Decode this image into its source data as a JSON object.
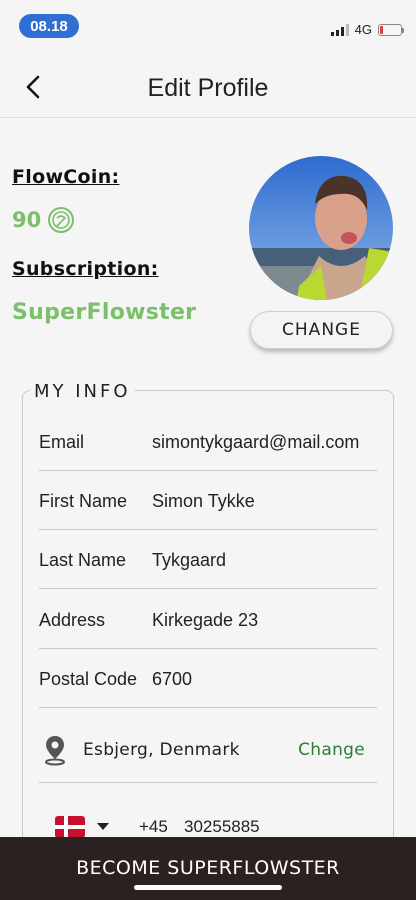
{
  "status_bar": {
    "time": "08.18",
    "network": "4G"
  },
  "header": {
    "title": "Edit Profile",
    "back_icon": "chevron-left-icon"
  },
  "profile": {
    "flowcoin_label": "FlowCoin:",
    "flowcoin_value": "90",
    "coin_icon": "flowcoin-icon",
    "subscription_label": "Subscription:",
    "subscription_value": "SuperFlowster",
    "change_photo_label": "CHANGE"
  },
  "my_info": {
    "legend": "MY INFO",
    "fields": [
      {
        "label": "Email",
        "value": "simontykgaard@mail.com"
      },
      {
        "label": "First Name",
        "value": "Simon Tykke"
      },
      {
        "label": "Last Name",
        "value": "Tykgaard"
      },
      {
        "label": "Address",
        "value": "Kirkegade 23"
      },
      {
        "label": "Postal Code",
        "value": "6700"
      }
    ],
    "location": {
      "icon": "location-pin-icon",
      "text": "Esbjerg, Denmark",
      "change_label": "Change"
    },
    "phone": {
      "flag_icon": "denmark-flag-icon",
      "code": "+45",
      "number": "30255885"
    }
  },
  "bottom_bar": {
    "label": "BECOME SUPERFLOWSTER"
  },
  "colors": {
    "accent_green": "#7bbf6a",
    "link_green": "#2f7d32",
    "time_pill": "#2f6fd3",
    "bottom_bar": "#2a2120"
  }
}
